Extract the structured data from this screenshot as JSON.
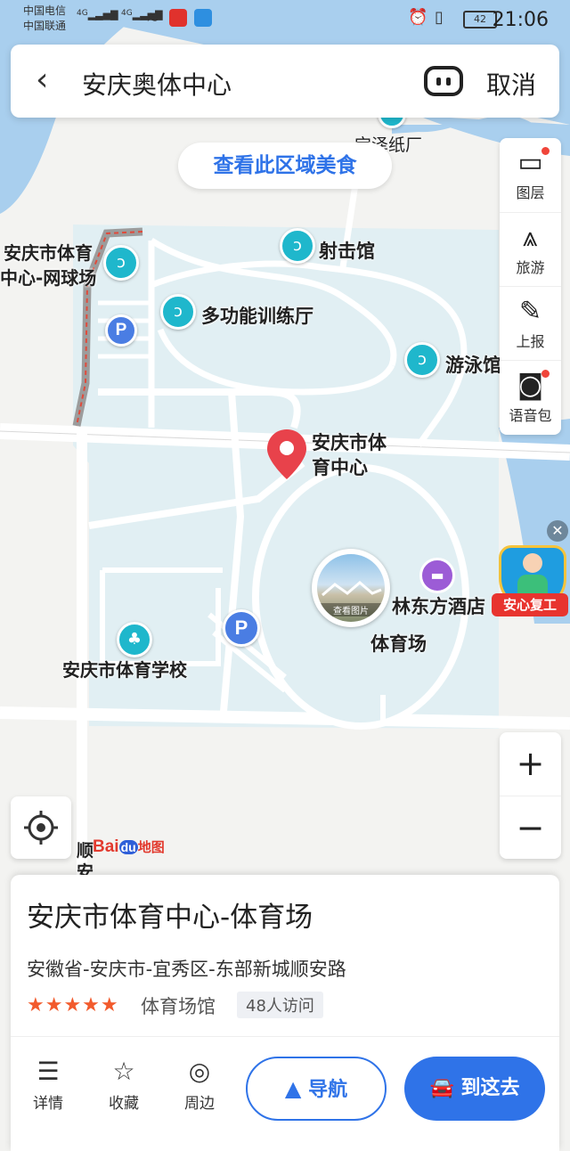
{
  "status_bar": {
    "carrier1": "中国电信",
    "carrier2": "中国联通",
    "net1": "4G",
    "net2": "4G",
    "battery": "42",
    "time": "21:06"
  },
  "search": {
    "query": "安庆奥体中心",
    "cancel": "取消"
  },
  "food_button": "查看此区域美食",
  "tools": [
    {
      "icon": "layers-icon",
      "label": "图层"
    },
    {
      "icon": "travel-icon",
      "label": "旅游"
    },
    {
      "icon": "report-icon",
      "label": "上报"
    },
    {
      "icon": "voice-pack-icon",
      "label": "语音包"
    }
  ],
  "map_labels": {
    "paper_factory": "宝泽纸厂",
    "tennis_line1": "安庆市体育",
    "tennis_line2": "中心-网球场",
    "shooting": "射击馆",
    "training": "多功能训练厅",
    "swimming": "游泳馆",
    "center_line1": "安庆市体",
    "center_line2": "育中心",
    "hotel": "林东方酒店",
    "stadium": "体育场",
    "view_photo": "查看图片",
    "school": "安庆市体育学校",
    "road_partial1": "顺",
    "road_partial2": "安",
    "parking": "P",
    "badge": "安心复工",
    "logo_bai": "Bai",
    "logo_du": "du",
    "logo_map": "地图"
  },
  "card": {
    "title": "安庆市体育中心-体育场",
    "address": "安徽省-安庆市-宜秀区-东部新城顺安路",
    "rating_stars": "★★★★★",
    "category": "体育场馆",
    "visits": "48人访问",
    "actions": [
      {
        "icon": "details-list-icon",
        "label": "详情"
      },
      {
        "icon": "star-icon",
        "label": "收藏"
      },
      {
        "icon": "compass-icon",
        "label": "周边"
      }
    ],
    "navigate": "导航",
    "go_here": "到这去"
  },
  "colors": {
    "accent": "#2f73e8",
    "poi": "#1fb7cc",
    "park_area": "#e1eff3",
    "water": "#a9cfee"
  }
}
